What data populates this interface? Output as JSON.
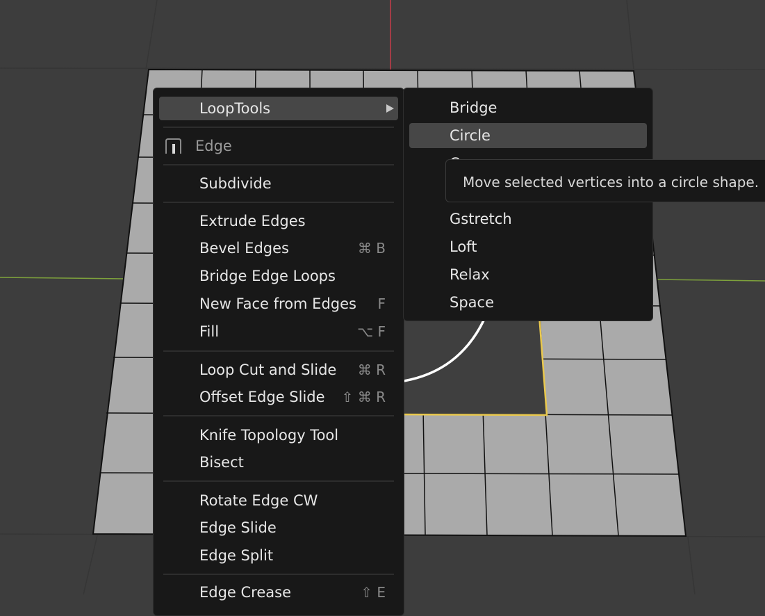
{
  "colors": {
    "viewport_bg": "#3d3d3d",
    "mesh_face": "#aaaaaa",
    "selected_edge": "#e9c84d",
    "axis_y": "#c43c4a",
    "axis_x": "#7ea23c",
    "menu_bg": "#181818",
    "menu_highlight": "#474747"
  },
  "edge_menu": {
    "looptools": {
      "label": "LoopTools",
      "icon": "submenu-arrow-icon"
    },
    "header": {
      "label": "Edge",
      "icon": "edge-mode-icon"
    },
    "subdivide": {
      "label": "Subdivide"
    },
    "extrude_edges": {
      "label": "Extrude Edges"
    },
    "bevel_edges": {
      "label": "Bevel Edges",
      "shortcut": "⌘ B"
    },
    "bridge_edge_loops": {
      "label": "Bridge Edge Loops"
    },
    "new_face_from_edges": {
      "label": "New Face from Edges",
      "shortcut": "F"
    },
    "fill": {
      "label": "Fill",
      "shortcut": "⌥ F"
    },
    "loop_cut_and_slide": {
      "label": "Loop Cut and Slide",
      "shortcut": "⌘ R"
    },
    "offset_edge_slide": {
      "label": "Offset Edge Slide",
      "shortcut": "⇧ ⌘ R"
    },
    "knife_topology_tool": {
      "label": "Knife Topology Tool"
    },
    "bisect": {
      "label": "Bisect"
    },
    "rotate_edge_cw": {
      "label": "Rotate Edge CW"
    },
    "edge_slide": {
      "label": "Edge Slide"
    },
    "edge_split": {
      "label": "Edge Split"
    },
    "edge_crease": {
      "label": "Edge Crease",
      "shortcut": "⇧ E"
    }
  },
  "looptools_menu": {
    "bridge": "Bridge",
    "circle": "Circle",
    "curve": "Curve",
    "gstretch": "Gstretch",
    "loft": "Loft",
    "relax": "Relax",
    "space": "Space"
  },
  "tooltip": {
    "text": "Move selected vertices into a circle shape."
  }
}
